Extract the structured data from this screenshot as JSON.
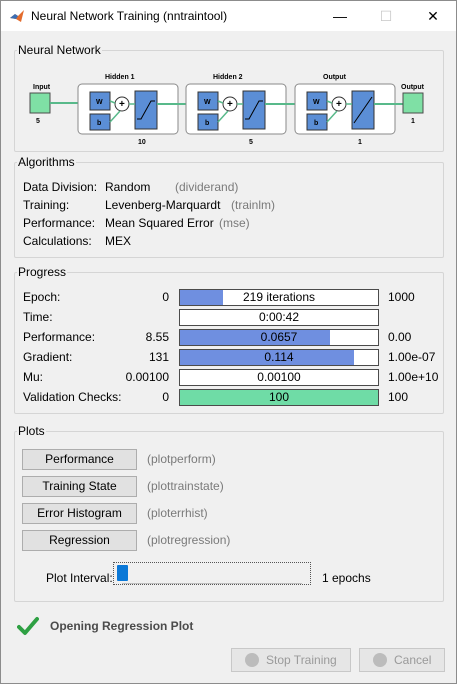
{
  "window": {
    "title": "Neural Network Training (nntraintool)",
    "controls": [
      "—",
      "☐",
      "✕"
    ]
  },
  "network": {
    "section_title": "Neural Network",
    "input_label": "Input",
    "input_size": "5",
    "hidden1_label": "Hidden 1",
    "hidden1_size": "10",
    "hidden2_label": "Hidden 2",
    "hidden2_size": "5",
    "output_layer_label": "Output",
    "output_layer_size": "1",
    "output_label": "Output",
    "output_size": "1",
    "weight_label": "W",
    "bias_label": "b",
    "colors": {
      "layer_block": "#5b8ed6",
      "io_block": "#7fe0a5",
      "connector": "#58b98a"
    }
  },
  "algorithms": {
    "section_title": "Algorithms",
    "rows": [
      {
        "label": "Data Division:",
        "value": "Random",
        "fn": "(dividerand)"
      },
      {
        "label": "Training:",
        "value": "Levenberg-Marquardt",
        "fn": "(trainlm)"
      },
      {
        "label": "Performance:",
        "value": "Mean Squared Error",
        "fn": "(mse)"
      },
      {
        "label": "Calculations:",
        "value": "MEX",
        "fn": ""
      }
    ]
  },
  "progress": {
    "section_title": "Progress",
    "rows": [
      {
        "label": "Epoch:",
        "start": "0",
        "bar_text": "219 iterations",
        "end": "1000",
        "fill": 0.219,
        "color": "blue"
      },
      {
        "label": "Time:",
        "start": "",
        "bar_text": "0:00:42",
        "end": "",
        "fill": 0,
        "color": "blue"
      },
      {
        "label": "Performance:",
        "start": "8.55",
        "bar_text": "0.0657",
        "end": "0.00",
        "fill": 0.76,
        "color": "blue"
      },
      {
        "label": "Gradient:",
        "start": "131",
        "bar_text": "0.114",
        "end": "1.00e-07",
        "fill": 0.88,
        "color": "blue"
      },
      {
        "label": "Mu:",
        "start": "0.00100",
        "bar_text": "0.00100",
        "end": "1.00e+10",
        "fill": 0,
        "color": "blue"
      },
      {
        "label": "Validation Checks:",
        "start": "0",
        "bar_text": "100",
        "end": "100",
        "fill": 1.0,
        "color": "green"
      }
    ]
  },
  "plots": {
    "section_title": "Plots",
    "buttons": [
      {
        "label": "Performance",
        "fn": "(plotperform)"
      },
      {
        "label": "Training State",
        "fn": "(plottrainstate)"
      },
      {
        "label": "Error Histogram",
        "fn": "(ploterrhist)"
      },
      {
        "label": "Regression",
        "fn": "(plotregression)"
      }
    ],
    "interval_label": "Plot Interval:",
    "interval_value": "1 epochs",
    "interval_position": 0
  },
  "status": {
    "message": "Opening Regression Plot",
    "icon": "checkmark-icon",
    "color": "#2ea043"
  },
  "actions": {
    "stop_label": "Stop Training",
    "cancel_label": "Cancel"
  }
}
